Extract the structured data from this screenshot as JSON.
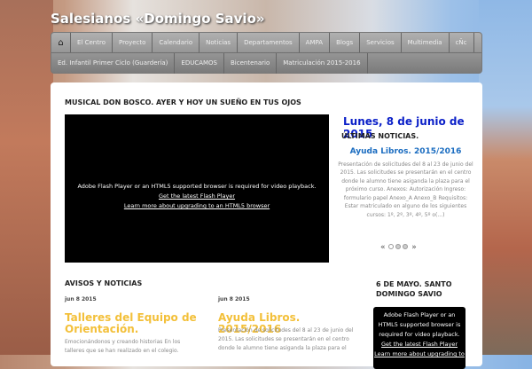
{
  "site_title": "Salesianos «Domingo Savio»",
  "nav": {
    "row1": [
      "El Centro",
      "Proyecto",
      "Calendario",
      "Noticias",
      "Departamentos",
      "AMPA",
      "Blogs",
      "Servicios",
      "Multimedia",
      "cÑc"
    ],
    "row2": [
      "Ed. Infantil Primer Ciclo (Guardería)",
      "EDUCAMOS",
      "Bicentenario",
      "Matriculación 2015-2016"
    ]
  },
  "featured": {
    "heading": "MUSICAL DON BOSCO. AYER Y HOY UN SUEÑO EN TUS OJOS",
    "flash_msg": "Adobe Flash Player or an HTML5 supported browser is required for video playback.",
    "flash_link": "Get the latest Flash Player",
    "html5_link": "Learn more about upgrading to an HTML5 browser"
  },
  "sidebar": {
    "date": "Lunes, 8 de junio de 2015",
    "heading": "ÚLTIMAS NOTICIAS.",
    "news_title": "Ayuda Libros. 2015/2016",
    "news_text": "Presentación de solicitudes del 8 al 23 de junio del 2015. Las solicitudes se presentarán en el centro donde le alumno tiene asiganda la plaza para el próximo curso. Anexos: Autorización Ingreso: formulario papel Anexo_A Anexo_B Requisitos: Estar matriculado en alguno de los siguientes cursos: 1º, 2º, 3º, 4º, 5º o(...)",
    "prev": "«",
    "next": "»"
  },
  "avisos": {
    "heading": "AVISOS Y NOTICIAS",
    "posts": [
      {
        "date": "jun 8 2015",
        "title": "Talleres del Equipo de Orientación.",
        "text": "Emocionándonos y creando historias En los talleres que se han realizado en el colegio."
      },
      {
        "date": "jun 8 2015",
        "title": "Ayuda Libros. 2015/2016",
        "text": "Presentación de solicitudes del 8 al 23 de junio del 2015. Las solicitudes se presentarán en el centro donde le alumno tiene asiganda la plaza para el"
      }
    ]
  },
  "savio": {
    "heading": "6 DE MAYO. SANTO DOMINGO SAVIO",
    "flash_msg": "Adobe Flash Player or an HTML5 supported browser is required for video playback.",
    "flash_link": "Get the latest Flash Player",
    "html5_link": "Learn more about upgrading to"
  }
}
